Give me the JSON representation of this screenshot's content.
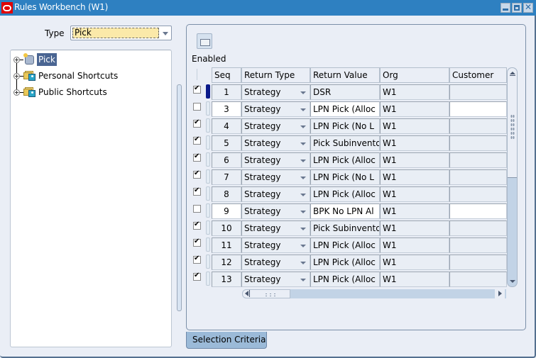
{
  "window": {
    "title": "Rules Workbench (W1)",
    "controls": [
      "minimize",
      "maximize",
      "close"
    ]
  },
  "type_field": {
    "label": "Type",
    "value": "Pick"
  },
  "tree": {
    "items": [
      {
        "label": "Pick",
        "icon": "rule-type-icon",
        "selected": true
      },
      {
        "label": "Personal Shortcuts",
        "icon": "personal-folder-icon",
        "selected": false
      },
      {
        "label": "Public Shortcuts",
        "icon": "public-folder-icon",
        "selected": false
      }
    ]
  },
  "toolbar": {
    "open_icon": "folder-open-icon"
  },
  "grid": {
    "enabled_label": "Enabled",
    "columns": [
      "Seq",
      "Return Type",
      "Return Value",
      "Org",
      "Customer"
    ],
    "rows": [
      {
        "enabled": true,
        "seq": "1",
        "return_type": "Strategy",
        "return_value": "DSR",
        "org": "W1",
        "customer": "",
        "current": true,
        "editable": false
      },
      {
        "enabled": false,
        "seq": "3",
        "return_type": "Strategy",
        "return_value": "LPN Pick (Alloc",
        "org": "W1",
        "customer": "",
        "current": false,
        "editable": true
      },
      {
        "enabled": true,
        "seq": "4",
        "return_type": "Strategy",
        "return_value": "LPN Pick (No L",
        "org": "W1",
        "customer": "",
        "current": false,
        "editable": false
      },
      {
        "enabled": true,
        "seq": "5",
        "return_type": "Strategy",
        "return_value": "Pick Subinvento",
        "org": "W1",
        "customer": "",
        "current": false,
        "editable": false
      },
      {
        "enabled": true,
        "seq": "6",
        "return_type": "Strategy",
        "return_value": "LPN Pick (Alloc",
        "org": "W1",
        "customer": "",
        "current": false,
        "editable": false
      },
      {
        "enabled": true,
        "seq": "7",
        "return_type": "Strategy",
        "return_value": "LPN Pick (No L",
        "org": "W1",
        "customer": "",
        "current": false,
        "editable": false
      },
      {
        "enabled": true,
        "seq": "8",
        "return_type": "Strategy",
        "return_value": "LPN Pick (Alloc",
        "org": "W1",
        "customer": "",
        "current": false,
        "editable": false
      },
      {
        "enabled": false,
        "seq": "9",
        "return_type": "Strategy",
        "return_value": "BPK No LPN Al",
        "org": "W1",
        "customer": "",
        "current": false,
        "editable": true
      },
      {
        "enabled": true,
        "seq": "10",
        "return_type": "Strategy",
        "return_value": "Pick Subinvento",
        "org": "W1",
        "customer": "",
        "current": false,
        "editable": false
      },
      {
        "enabled": true,
        "seq": "11",
        "return_type": "Strategy",
        "return_value": "LPN Pick (Alloc",
        "org": "W1",
        "customer": "",
        "current": false,
        "editable": false
      },
      {
        "enabled": true,
        "seq": "12",
        "return_type": "Strategy",
        "return_value": "LPN Pick (Alloc",
        "org": "W1",
        "customer": "",
        "current": false,
        "editable": false
      },
      {
        "enabled": true,
        "seq": "13",
        "return_type": "Strategy",
        "return_value": "LPN Pick (Alloc",
        "org": "W1",
        "customer": "",
        "current": false,
        "editable": false
      }
    ]
  },
  "tabs": [
    {
      "label": "Selection Criteria",
      "active": true
    }
  ],
  "colors": {
    "titlebar": "#2e80c1",
    "window_bg": "#eaeef6",
    "type_value_bg": "#fbe9a9",
    "tree_selected": "#4a6592",
    "current_row_indicator": "#0a1a8a",
    "tab_bg": "#9bbad8"
  }
}
